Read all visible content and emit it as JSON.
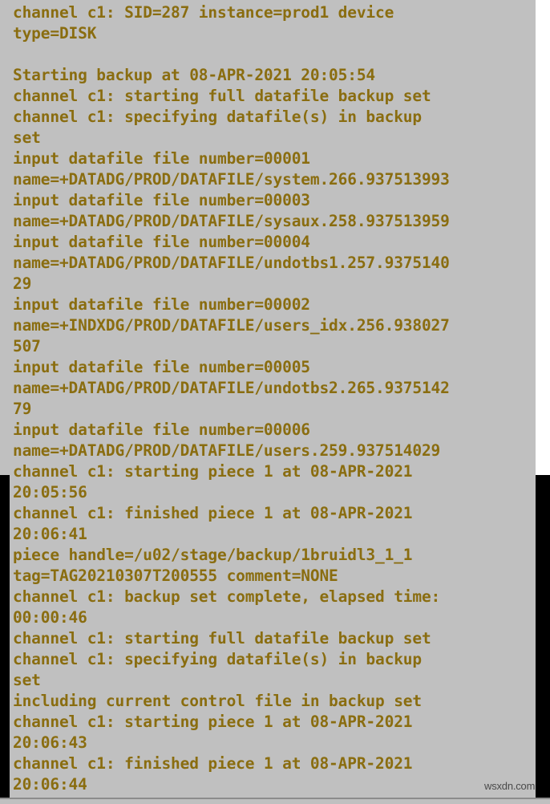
{
  "terminal": {
    "background_color": "#c0c0c0",
    "text_color": "#8a6d10",
    "bar_color": "#000000",
    "lines": [
      "channel c1: SID=287 instance=prod1 device",
      "type=DISK",
      "",
      "Starting backup at 08-APR-2021 20:05:54",
      "channel c1: starting full datafile backup set",
      "channel c1: specifying datafile(s) in backup",
      "set",
      "input datafile file number=00001",
      "name=+DATADG/PROD/DATAFILE/system.266.937513993",
      "input datafile file number=00003",
      "name=+DATADG/PROD/DATAFILE/sysaux.258.937513959",
      "input datafile file number=00004",
      "name=+DATADG/PROD/DATAFILE/undotbs1.257.9375140",
      "29",
      "input datafile file number=00002",
      "name=+INDXDG/PROD/DATAFILE/users_idx.256.938027",
      "507",
      "input datafile file number=00005",
      "name=+DATADG/PROD/DATAFILE/undotbs2.265.9375142",
      "79",
      "input datafile file number=00006",
      "name=+DATADG/PROD/DATAFILE/users.259.937514029",
      "channel c1: starting piece 1 at 08-APR-2021",
      "20:05:56",
      "channel c1: finished piece 1 at 08-APR-2021",
      "20:06:41",
      "piece handle=/u02/stage/backup/1bruidl3_1_1",
      "tag=TAG20210307T200555 comment=NONE",
      "channel c1: backup set complete, elapsed time:",
      "00:00:46",
      "channel c1: starting full datafile backup set",
      "channel c1: specifying datafile(s) in backup",
      "set",
      "including current control file in backup set",
      "channel c1: starting piece 1 at 08-APR-2021",
      "20:06:43",
      "channel c1: finished piece 1 at 08-APR-2021",
      "20:06:44"
    ]
  },
  "watermark": {
    "text": "wsxdn.com"
  }
}
